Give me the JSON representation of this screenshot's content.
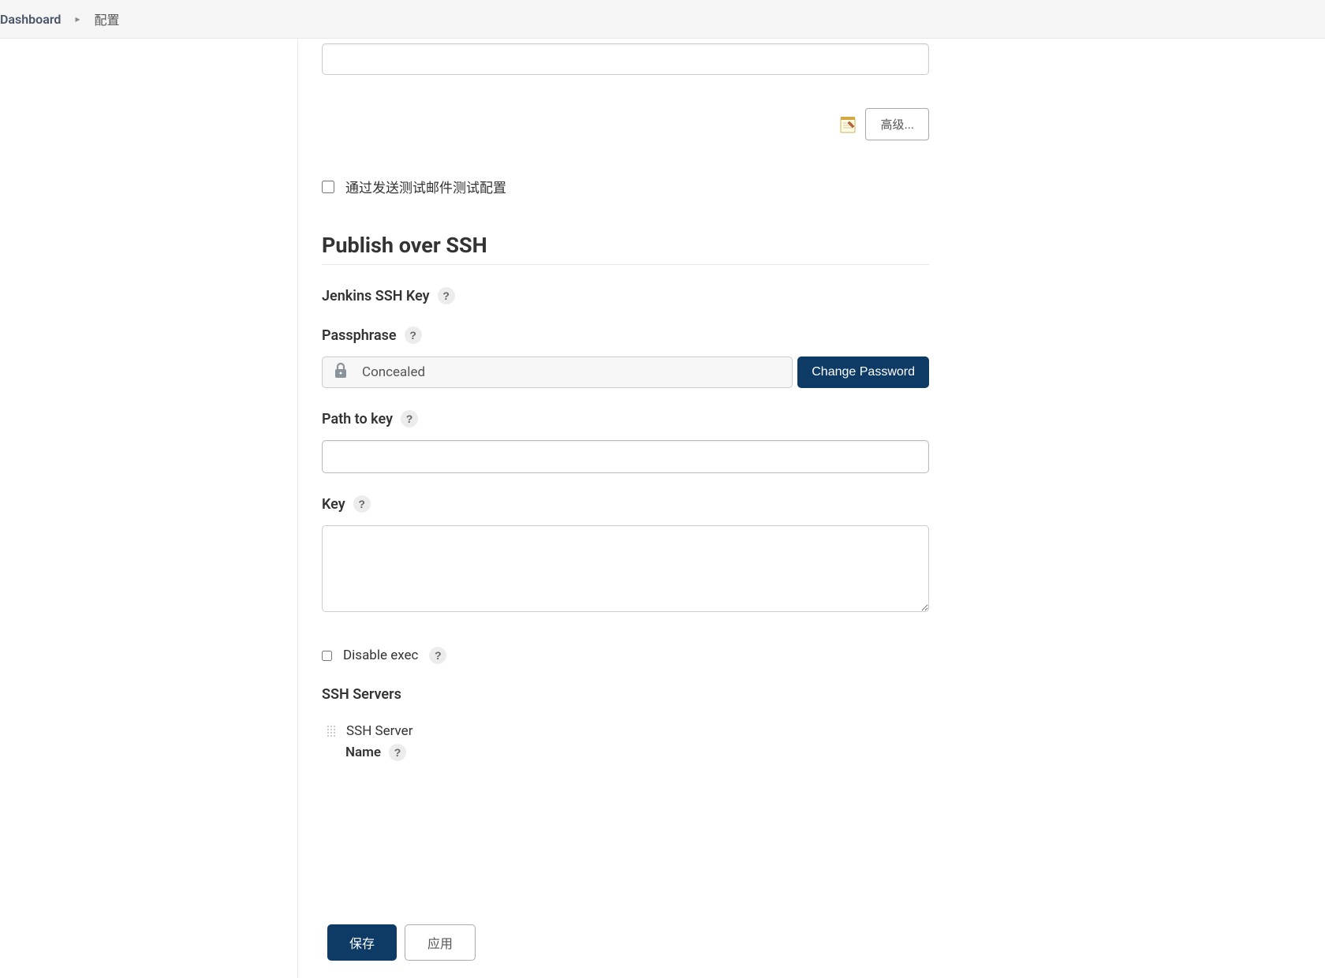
{
  "breadcrumb": {
    "dashboard": "Dashboard",
    "current": "配置"
  },
  "advanced_button": "高级...",
  "test_email_checkbox": "通过发送测试邮件测试配置",
  "section_title": "Publish over SSH",
  "jenkins_ssh_key_label": "Jenkins SSH Key",
  "passphrase": {
    "label": "Passphrase",
    "concealed": "Concealed",
    "change_button": "Change Password"
  },
  "path_to_key": {
    "label": "Path to key",
    "value": ""
  },
  "key": {
    "label": "Key",
    "value": ""
  },
  "disable_exec_label": "Disable exec",
  "ssh_servers": {
    "label": "SSH Servers",
    "server_label": "SSH Server",
    "name_label": "Name"
  },
  "buttons": {
    "save": "保存",
    "apply": "应用"
  }
}
